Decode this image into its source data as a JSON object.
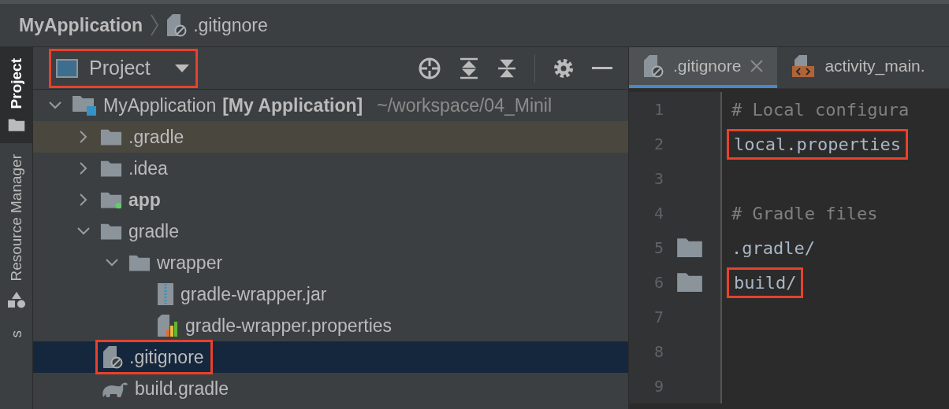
{
  "breadcrumb": [
    {
      "label": "MyApplication",
      "bold": true,
      "kind": "project"
    },
    {
      "label": ".gitignore",
      "bold": false,
      "kind": "gitignore"
    }
  ],
  "tool_stripe": [
    {
      "label": "Project",
      "selected": true,
      "kind": "folder"
    },
    {
      "label": "Resource Manager",
      "selected": false,
      "kind": "shapes"
    },
    {
      "label": "s",
      "selected": false,
      "kind": "plain"
    }
  ],
  "project_panel": {
    "view_selector": {
      "label": "Project",
      "highlighted": true
    },
    "tree": [
      {
        "label": "MyApplication",
        "module": "[My Application]",
        "path": "~/workspace/04_Minil",
        "kind": "module",
        "expanded": true,
        "selected": false,
        "excluded": false,
        "bold": false,
        "highlighted": false,
        "children": [
          {
            "label": ".gradle",
            "kind": "folder",
            "expanded": false,
            "selected": false,
            "excluded": true,
            "bold": false,
            "highlighted": false
          },
          {
            "label": ".idea",
            "kind": "folder",
            "expanded": false,
            "selected": false,
            "excluded": false,
            "bold": false,
            "highlighted": false
          },
          {
            "label": "app",
            "kind": "app-module",
            "expanded": false,
            "selected": false,
            "excluded": false,
            "bold": true,
            "highlighted": false
          },
          {
            "label": "gradle",
            "kind": "folder",
            "expanded": true,
            "selected": false,
            "excluded": false,
            "bold": false,
            "highlighted": false,
            "children": [
              {
                "label": "wrapper",
                "kind": "folder",
                "expanded": true,
                "selected": false,
                "excluded": false,
                "bold": false,
                "highlighted": false,
                "children": [
                  {
                    "label": "gradle-wrapper.jar",
                    "kind": "jar",
                    "selected": false,
                    "excluded": false,
                    "bold": false,
                    "highlighted": false
                  },
                  {
                    "label": "gradle-wrapper.properties",
                    "kind": "properties",
                    "selected": false,
                    "excluded": false,
                    "bold": false,
                    "highlighted": false
                  }
                ]
              }
            ]
          },
          {
            "label": ".gitignore",
            "kind": "gitignore",
            "selected": true,
            "excluded": false,
            "bold": false,
            "highlighted": true
          },
          {
            "label": "build.gradle",
            "kind": "gradle",
            "selected": false,
            "excluded": false,
            "bold": false,
            "highlighted": false
          }
        ]
      }
    ]
  },
  "editor": {
    "tabs": [
      {
        "label": ".gitignore",
        "kind": "gitignore",
        "selected": true
      },
      {
        "label": "activity_main.",
        "kind": "xml",
        "selected": false
      }
    ],
    "lines": [
      {
        "number": "1",
        "kind": "comment",
        "text": "# Local configura",
        "highlighted": false
      },
      {
        "number": "2",
        "kind": "file",
        "text": "local.properties",
        "highlighted": true
      },
      {
        "number": "3",
        "kind": "blank",
        "highlighted": false
      },
      {
        "number": "4",
        "kind": "comment",
        "text": "# Gradle files",
        "highlighted": false
      },
      {
        "number": "5",
        "kind": "folder",
        "text": ".gradle/",
        "highlighted": false
      },
      {
        "number": "6",
        "kind": "folder",
        "text": "build/",
        "highlighted": true
      },
      {
        "number": "7",
        "kind": "blank",
        "highlighted": false
      },
      {
        "number": "8",
        "kind": "blank",
        "highlighted": false
      },
      {
        "number": "9",
        "kind": "blank",
        "highlighted": false
      }
    ]
  }
}
